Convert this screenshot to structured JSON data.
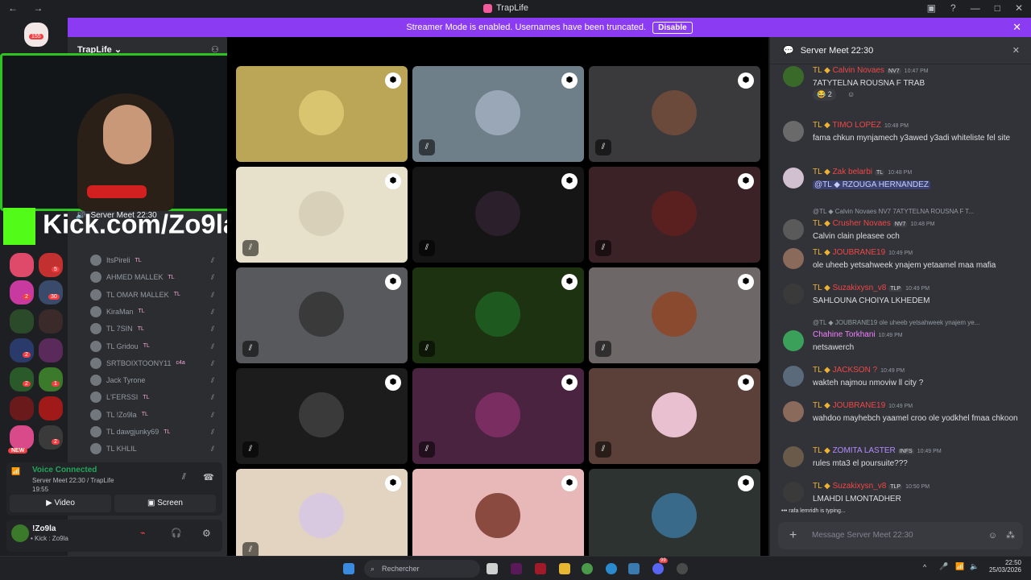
{
  "titlebar": {
    "app_title": "TrapLife",
    "nav": "← →",
    "controls": [
      "▣",
      "?",
      "—",
      "□",
      "✕"
    ]
  },
  "banner": {
    "text": "Streamer Mode is enabled. Usernames have been truncated.",
    "disable_label": "Disable",
    "close": "✕"
  },
  "serverlist": {
    "home_badge": "155",
    "new_badge": "NEW",
    "badges": [
      "5",
      "2",
      "30",
      "2",
      "2",
      "1",
      "2"
    ]
  },
  "server": {
    "name": "TrapLife ⌄",
    "voice_channel": "Server Meet 22:30"
  },
  "voice_members": [
    {
      "name": "ItsPireli",
      "suffix": "TL"
    },
    {
      "name": "AHMED MALLEK",
      "suffix": "TL"
    },
    {
      "name": "TL OMAR MALLEK",
      "suffix": "TL"
    },
    {
      "name": "KiraMan",
      "suffix": "TL"
    },
    {
      "name": "TL 7SIN",
      "suffix": "TL"
    },
    {
      "name": "TL Gridou",
      "suffix": "TL"
    },
    {
      "name": "SRTBOIXTOONY11",
      "suffix": "c4a"
    },
    {
      "name": "Jack Tyrone",
      "suffix": ""
    },
    {
      "name": "L'FERSSI",
      "suffix": "TL"
    },
    {
      "name": "TL !Zo9la",
      "suffix": "TL"
    },
    {
      "name": "TL dawgjunky69",
      "suffix": "TL"
    },
    {
      "name": "TL KHLIL",
      "suffix": ""
    }
  ],
  "overlay": {
    "kick_text": "Kick.com/Zo9la"
  },
  "voice_status": {
    "title": "Voice Connected",
    "channel": "Server Meet 22:30 / TrapLife",
    "timer": "19:55",
    "video_label": "Video",
    "screen_label": "Screen"
  },
  "user_panel": {
    "name": "!Zo9la",
    "status": "• Kick : Zo9la"
  },
  "stage_tiles": [
    {
      "bg": "#bba657",
      "av": "#d9c56f",
      "mute": false
    },
    {
      "bg": "#6e7f8a",
      "av": "#9aa7b7",
      "mute": true
    },
    {
      "bg": "#3a3a3c",
      "av": "#6b4a3c",
      "mute": true
    },
    {
      "bg": "#e7e0cb",
      "av": "#d8d0b9",
      "mute": true
    },
    {
      "bg": "#151515",
      "av": "#2a1f2a",
      "mute": true
    },
    {
      "bg": "#3a2226",
      "av": "#5a2020",
      "mute": true
    },
    {
      "bg": "#57595c",
      "av": "#3a3a3a",
      "mute": true
    },
    {
      "bg": "#1d3210",
      "av": "#1e5a20",
      "mute": true
    },
    {
      "bg": "#6e6768",
      "av": "#8a4a30",
      "mute": true
    },
    {
      "bg": "#1c1c1c",
      "av": "#3a3a3a",
      "mute": true
    },
    {
      "bg": "#4a2340",
      "av": "#7a2d60",
      "mute": true
    },
    {
      "bg": "#5a4038",
      "av": "#e8c0d0",
      "mute": true
    },
    {
      "bg": "#e2d4c0",
      "av": "#d8c8e0",
      "mute": true
    },
    {
      "bg": "#e8b8b8",
      "av": "#8a4a40",
      "mute": false
    },
    {
      "bg": "#2c3330",
      "av": "#3a6a8a",
      "mute": false
    }
  ],
  "chat": {
    "header": "Server Meet 22:30",
    "reaction": "😂 2",
    "typing": "rafa lemridh is typing...",
    "input_placeholder": "Message Server Meet 22:30",
    "messages": [
      {
        "tl": "TL ◆",
        "name": "Calvin Novaes",
        "tag": "NV7",
        "time": "10:47 PM",
        "text": "7ATYTELNA ROUSNA F TRAB",
        "color": "#f04747",
        "av": "#3a6a2a"
      },
      {
        "tl": "TL ◆",
        "name": "TIMO LOPEZ",
        "tag": "",
        "time": "10:48 PM",
        "text": "fama chkun mynjamech y3awed y3adi whiteliste fel site",
        "color": "#f04747",
        "av": "#6a6a6a"
      },
      {
        "tl": "TL ◆",
        "name": "Zak belarbi",
        "tag": "TL",
        "time": "10:48 PM",
        "text": "@TL ◆ RZOUGA HERNANDEZ",
        "color": "#f04747",
        "av": "#d0c0d0"
      },
      {
        "tl": "TL ◆",
        "name": "Crusher Novaes",
        "tag": "NV7",
        "time": "10:48 PM",
        "text": "Calvin clain pleasee och",
        "color": "#f04747",
        "av": "#5a5a5a",
        "reply": "@TL ◆ Calvin Novaes NV7 7ATYTELNA ROUSNA F T..."
      },
      {
        "tl": "TL ◆",
        "name": "JOUBRANE19",
        "tag": "",
        "time": "10:49 PM",
        "text": "ole uheeb yetsahweek ynajem yetaamel maa mafia",
        "color": "#f04747",
        "av": "#8a6a5a"
      },
      {
        "tl": "TL ◆",
        "name": "Suzakixysn_v8",
        "tag": "TLP",
        "time": "10:49 PM",
        "text": "SAHLOUNA CHOIYA LKHEDEM",
        "color": "#f04747",
        "av": "#3a3a3a"
      },
      {
        "tl": "",
        "name": "Chahine Torkhani",
        "tag": "",
        "time": "10:49 PM",
        "text": "netsawerch",
        "color": "#f47fff",
        "av": "#3aa05a",
        "reply": "@TL ◆ JOUBRANE19 ole uheeb yetsahweek ynajem ye..."
      },
      {
        "tl": "TL ◆",
        "name": "JACKSON ?",
        "tag": "",
        "time": "10:49 PM",
        "text": "wakteh najmou nmoviw ll city ?",
        "color": "#f04747",
        "av": "#5a6a7a"
      },
      {
        "tl": "TL ◆",
        "name": "JOUBRANE19",
        "tag": "",
        "time": "10:49 PM",
        "text": "wahdoo mayhebch yaamel croo ole yodkhel fmaa chkoon",
        "color": "#f04747",
        "av": "#8a6a5a"
      },
      {
        "tl": "TL ◆",
        "name": "ZOMITA LASTER",
        "tag": "INFS",
        "time": "10:49 PM",
        "text": "rules mta3 el poursuite???",
        "color": "#b48cff",
        "av": "#6a5a4a"
      },
      {
        "tl": "TL ◆",
        "name": "Suzakixysn_v8",
        "tag": "TLP",
        "time": "10:50 PM",
        "text": "LMAHDI LMONTADHER",
        "color": "#f04747",
        "av": "#3a3a3a"
      }
    ]
  },
  "taskbar": {
    "search_placeholder": "Rechercher",
    "time": "22:50",
    "date": "25/03/2026",
    "discord_badge": "99"
  },
  "colors": {
    "accent": "#8b3cf3",
    "bg": "#313338",
    "kick_green": "#53fc18"
  }
}
